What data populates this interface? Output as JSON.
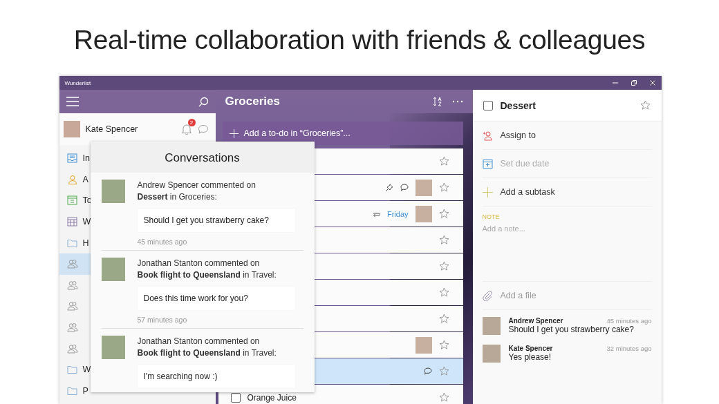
{
  "headline": "Real-time collaboration with friends & colleagues",
  "window": {
    "title": "Wunderlist"
  },
  "sidebar": {
    "user": {
      "name": "Kate Spencer",
      "notification_count": "2"
    },
    "items": [
      {
        "kind": "inbox",
        "label": "In",
        "selected": false
      },
      {
        "kind": "assigned",
        "label": "A",
        "selected": false
      },
      {
        "kind": "today",
        "label": "To",
        "selected": false
      },
      {
        "kind": "week",
        "label": "W",
        "selected": false
      },
      {
        "kind": "folder",
        "label": "H",
        "selected": false
      },
      {
        "kind": "shared",
        "selected": true
      },
      {
        "kind": "shared",
        "selected": false
      },
      {
        "kind": "shared",
        "selected": false
      },
      {
        "kind": "shared",
        "selected": false
      },
      {
        "kind": "shared",
        "selected": false
      },
      {
        "kind": "folder",
        "label": "W",
        "selected": false
      },
      {
        "kind": "folder",
        "label": "P",
        "selected": false
      }
    ]
  },
  "list": {
    "title": "Groceries",
    "add_placeholder": "Add a to-do in “Groceries”...",
    "tasks": [
      {
        "selected": false,
        "starred": false,
        "pinned": false,
        "commented": false,
        "recurring": false,
        "assigned": false
      },
      {
        "selected": false,
        "starred": false,
        "pinned": true,
        "commented": true,
        "recurring": false,
        "assigned": true
      },
      {
        "selected": false,
        "starred": false,
        "pinned": false,
        "commented": false,
        "recurring": true,
        "due": "Friday",
        "assigned": true
      },
      {
        "selected": false,
        "starred": false,
        "pinned": false,
        "commented": false,
        "recurring": false,
        "assigned": false
      },
      {
        "selected": false,
        "starred": false,
        "pinned": false,
        "commented": false,
        "recurring": false,
        "assigned": false
      },
      {
        "selected": false,
        "starred": false,
        "pinned": false,
        "commented": false,
        "recurring": false,
        "assigned": false
      },
      {
        "selected": false,
        "starred": false,
        "pinned": false,
        "commented": false,
        "recurring": false,
        "assigned": false
      },
      {
        "selected": false,
        "starred": false,
        "pinned": false,
        "commented": false,
        "recurring": false,
        "assigned": true
      },
      {
        "selected": true,
        "starred": false,
        "pinned": false,
        "commented": true,
        "recurring": false,
        "assigned": false
      },
      {
        "title": "Orange Juice",
        "selected": false,
        "checked": false,
        "starred": false,
        "pinned": false,
        "commented": false,
        "recurring": false,
        "assigned": false
      }
    ]
  },
  "conversations": {
    "title": "Conversations",
    "entries": [
      {
        "text": "Andrew Spencer commented on\n**Dessert** in Groceries:",
        "message": "Should I get you strawberry cake?",
        "time": "45 minutes ago"
      },
      {
        "text": "Jonathan Stanton commented on\n**Book flight to Queensland** in Travel:",
        "message": "Does this time work for you?",
        "time": "57 minutes ago"
      },
      {
        "text": "Jonathan Stanton commented on\n**Book flight to Queensland** in Travel:",
        "message": "I'm searching now :)"
      }
    ]
  },
  "detail": {
    "title": "Dessert",
    "checked": false,
    "starred": false,
    "actions": [
      {
        "kind": "assign",
        "label": "Assign to",
        "disabled": false
      },
      {
        "kind": "due",
        "label": "Set due date",
        "disabled": true
      },
      {
        "kind": "subtask",
        "label": "Add a subtask",
        "disabled": false
      }
    ],
    "note_label": "NOTE",
    "note_placeholder": "Add a note...",
    "file_label": "Add a file",
    "comments": [
      {
        "author": "Andrew Spencer",
        "time": "45 minutes ago",
        "text": "Should I get you strawberry cake?"
      },
      {
        "author": "Kate Spencer",
        "time": "32 minutes ago",
        "text": "Yes please!"
      }
    ]
  }
}
